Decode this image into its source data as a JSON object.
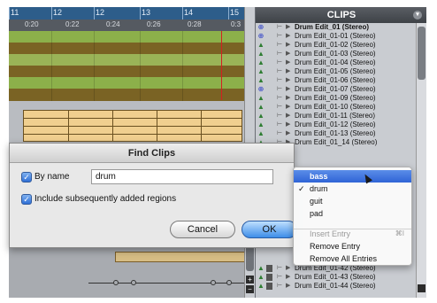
{
  "ruler": {
    "bars": [
      "11",
      "12",
      "13",
      "14",
      "15"
    ],
    "times": [
      "0:20",
      "0:22",
      "0:24",
      "0:26",
      "0:28",
      "0:3"
    ],
    "track_colors": [
      "#8cb04a",
      "#7a6324",
      "#9ab457",
      "#7a6324",
      "#8cb04a",
      "#7a6324"
    ]
  },
  "clips": {
    "title": "CLIPS",
    "top_items": [
      {
        "type": "group",
        "name": "Drum Edit_01 (Stereo)"
      },
      {
        "type": "group",
        "name": "Drum Edit_01-01 (Stereo)"
      },
      {
        "type": "audio",
        "name": "Drum Edit_01-02 (Stereo)"
      },
      {
        "type": "audio",
        "name": "Drum Edit_01-03 (Stereo)"
      },
      {
        "type": "audio",
        "name": "Drum Edit_01-04 (Stereo)"
      },
      {
        "type": "audio",
        "name": "Drum Edit_01-05 (Stereo)"
      },
      {
        "type": "audio",
        "name": "Drum Edit_01-06 (Stereo)"
      },
      {
        "type": "group",
        "name": "Drum Edit_01-07 (Stereo)"
      },
      {
        "type": "audio",
        "name": "Drum Edit_01-09 (Stereo)"
      },
      {
        "type": "audio",
        "name": "Drum Edit_01-10 (Stereo)"
      },
      {
        "type": "audio",
        "name": "Drum Edit_01-11 (Stereo)"
      },
      {
        "type": "audio",
        "name": "Drum Edit_01-12 (Stereo)"
      },
      {
        "type": "audio",
        "name": "Drum Edit_01-13 (Stereo)"
      },
      {
        "type": "audio",
        "name": "Drum Edit_01_14 (Stereo)"
      }
    ],
    "bottom_items": [
      {
        "type": "audio",
        "name": "Drum Edit_01-42 (Stereo)"
      },
      {
        "type": "audio",
        "name": "Drum Edit_01-43 (Stereo)"
      },
      {
        "type": "audio",
        "name": "Drum Edit_01-44 (Stereo)"
      }
    ]
  },
  "dialog": {
    "title": "Find Clips",
    "by_name_label": "By name",
    "name_value": "drum",
    "include_label": "Include subsequently added regions",
    "cancel_label": "Cancel",
    "ok_label": "OK"
  },
  "menu": {
    "entries": [
      "bass",
      "drum",
      "guit",
      "pad"
    ],
    "checked": "✓",
    "insert_entry": "Insert Entry",
    "insert_shortcut": "⌘I",
    "remove_entry": "Remove Entry",
    "remove_all": "Remove All Entries"
  }
}
